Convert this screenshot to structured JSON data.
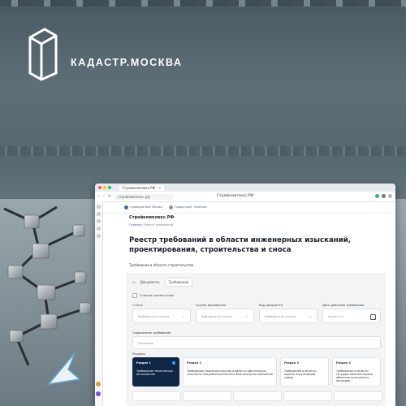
{
  "logo": {
    "text": "КАДАСТР.МОСКВА"
  },
  "browser": {
    "tab_title": "Стройкомплекс.РФ",
    "url": "стройкомплекс.рф",
    "page_title": "Стройкомплекс.РФ"
  },
  "site": {
    "brand1": "Стройкомплекс Москвы",
    "brand2": "Градостроит. политика",
    "name": "Стройкомплекс.РФ",
    "breadcrumb_home": "Главная",
    "breadcrumb_current": "Реестр требований",
    "heading": "Реестр требований в области инженерных изысканий, проектирования, строительства и сноса",
    "subheading": "Требования в области строительства"
  },
  "panel": {
    "tab_documents": "Документы",
    "tab_requirements": "Требования",
    "checkbox_label": "Строгое соответствие",
    "filters": [
      {
        "label": "Статус",
        "placeholder": "Выберите из списка"
      },
      {
        "label": "Группа документов",
        "placeholder": "Выберите из списка"
      },
      {
        "label": "Вид документа",
        "placeholder": "Выберите из списка"
      },
      {
        "label": "Дата действия требования",
        "placeholder": "дд.мм.гггг"
      }
    ],
    "content_label": "Содержание требования",
    "content_placeholder": "Например",
    "sections_label": "Разделы",
    "sections": [
      {
        "title": "Раздел 1",
        "text": "Требования технических регламентов"
      },
      {
        "title": "Раздел 2",
        "text": "Требования законодательства в области обеспечения санитарно-эпидемиологического благополучия населения"
      },
      {
        "title": "Раздел 3",
        "text": "Требования в области охраны окружающей среды"
      },
      {
        "title": "Раздел 4",
        "text": "Требования в области государственной охраны объектов культурного наследия"
      }
    ]
  }
}
